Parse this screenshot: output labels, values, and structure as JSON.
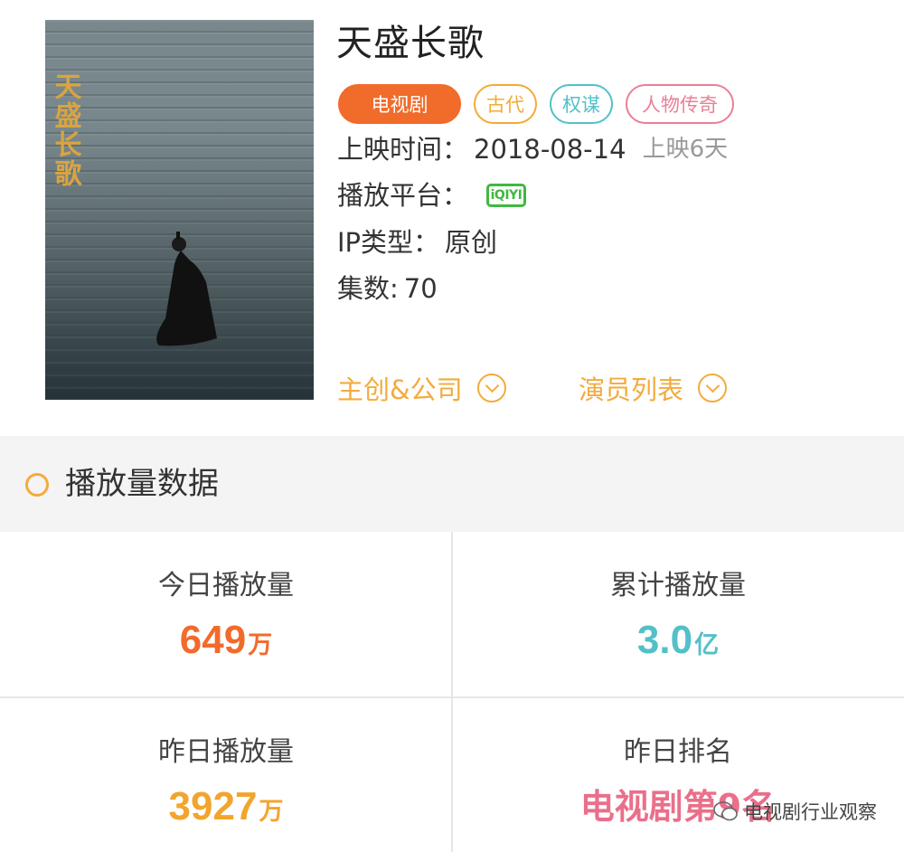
{
  "show": {
    "title": "天盛长歌",
    "tags": [
      "电视剧",
      "古代",
      "权谋",
      "人物传奇"
    ],
    "release_label": "上映时间：",
    "release_date": "2018-08-14",
    "release_days": "上映6天",
    "platform_label": "播放平台：",
    "platform_logo": "iQIYI",
    "ip_label": "IP类型：",
    "ip_value": "原创",
    "episodes_label": "集数:",
    "episodes_value": "70",
    "poster_title": "天盛长歌",
    "links": [
      "主创&公司",
      "演员列表"
    ]
  },
  "section": {
    "title": "播放量数据"
  },
  "stats": [
    {
      "label": "今日播放量",
      "value": "649",
      "unit": "万",
      "color": "#f16b2b"
    },
    {
      "label": "累计播放量",
      "value": "3.0",
      "unit": "亿",
      "color": "#53c0c9"
    },
    {
      "label": "昨日播放量",
      "value": "3927",
      "unit": "万",
      "color": "#f2a52d"
    },
    {
      "label": "昨日排名",
      "value": "电视剧第9名",
      "unit": "",
      "color": "#ea6f8b"
    }
  ],
  "watermark": {
    "text": "电视剧行业观察"
  }
}
